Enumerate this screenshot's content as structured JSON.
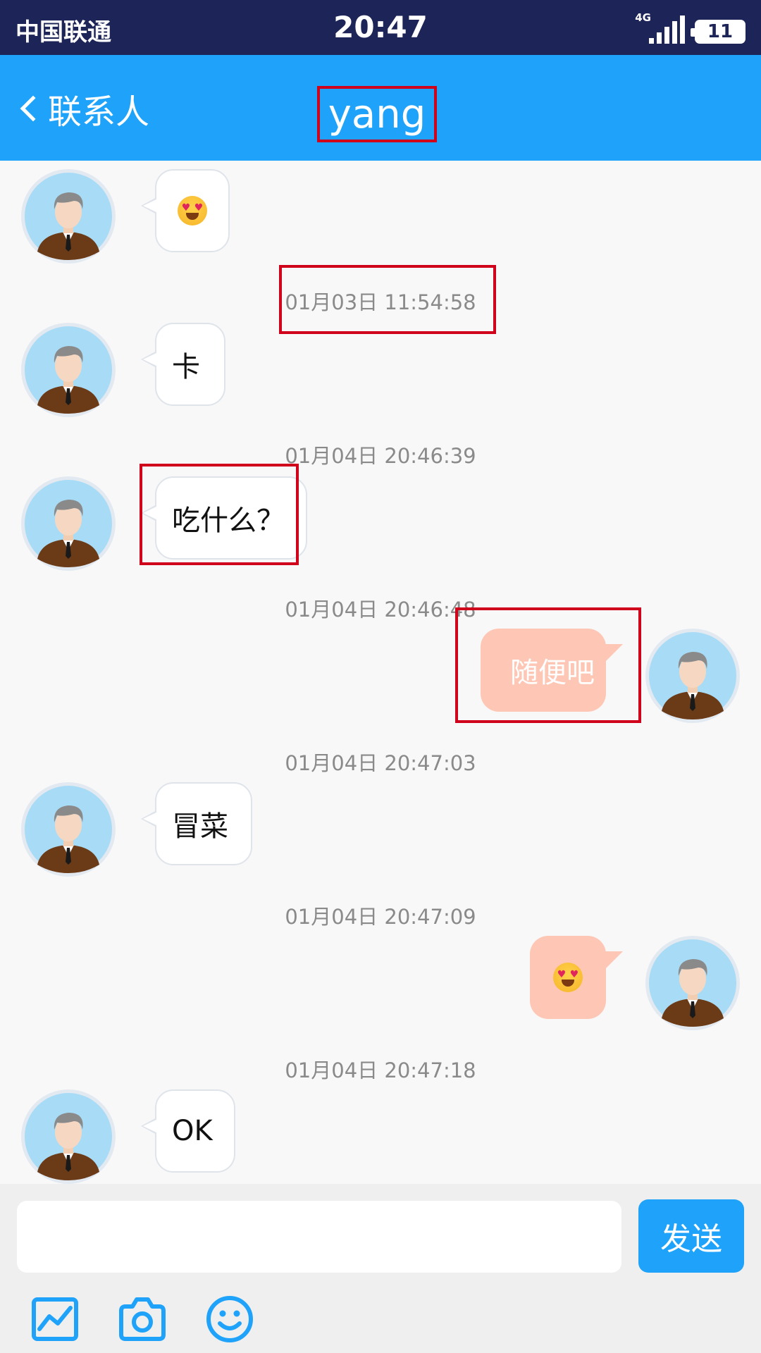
{
  "status_bar": {
    "carrier": "中国联通",
    "time": "20:47",
    "network": "4G",
    "battery": "11"
  },
  "nav": {
    "back_label": "联系人",
    "title": "yang"
  },
  "messages": [
    {
      "direction": "in",
      "type": "emoji",
      "emoji": "smiling-face-with-heart-eyes"
    },
    {
      "timestamp": "01月03日 11:54:58"
    },
    {
      "direction": "in",
      "type": "text",
      "text": "卡"
    },
    {
      "timestamp": "01月04日 20:46:39"
    },
    {
      "direction": "in",
      "type": "text",
      "text": "吃什么？"
    },
    {
      "timestamp": "01月04日 20:46:48"
    },
    {
      "direction": "out",
      "type": "text",
      "text": "随便吧"
    },
    {
      "timestamp": "01月04日 20:47:03"
    },
    {
      "direction": "in",
      "type": "text",
      "text": "冒菜"
    },
    {
      "timestamp": "01月04日 20:47:09"
    },
    {
      "direction": "out",
      "type": "emoji",
      "emoji": "smiling-face-with-heart-eyes"
    },
    {
      "timestamp": "01月04日 20:47:18"
    },
    {
      "direction": "in",
      "type": "text",
      "text": "OK"
    }
  ],
  "input": {
    "value": "",
    "send_label": "发送"
  },
  "toolbar": {
    "icons": [
      "image-icon",
      "camera-icon",
      "emoji-icon"
    ]
  },
  "colors": {
    "status_bar": "#1d2457",
    "accent": "#1fa3fa",
    "outgoing_bubble": "#fec6b4",
    "incoming_bubble": "#ffffff",
    "highlight_box": "#d0021b"
  }
}
